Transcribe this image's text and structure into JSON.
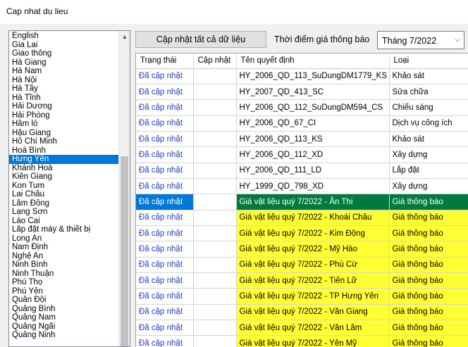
{
  "window": {
    "title": "Cap nhat du lieu"
  },
  "provinces": [
    "English",
    "Gia Lai",
    "Giao thông",
    "Hà Giang",
    "Hà Nam",
    "Hà Nội",
    "Hà Tây",
    "Hà Tĩnh",
    "Hải Dương",
    "Hải Phòng",
    "Hầm lò",
    "Hậu Giang",
    "Hồ Chí Minh",
    "Hoà Bình",
    "Hưng Yên",
    "Khánh Hoà",
    "Kiên Giang",
    "Kon Tum",
    "Lai Châu",
    "Lâm Đồng",
    "Lạng Sơn",
    "Lào Cai",
    "Lắp đặt máy & thiết bị",
    "Long An",
    "Nam Định",
    "Nghệ An",
    "Ninh Bình",
    "Ninh Thuận",
    "Phú Thọ",
    "Phú Yên",
    "Quân Đội",
    "Quảng Bình",
    "Quảng Nam",
    "Quảng Ngãi",
    "Quảng Ninh"
  ],
  "selected_province": "Hưng Yên",
  "toolbar": {
    "update_all_label": "Cập nhật tất cả dữ liệu",
    "time_label": "Thời điểm giá thông báo",
    "time_value": "Tháng 7/2022"
  },
  "grid": {
    "columns": [
      "Trạng thái",
      "Cập nhật",
      "Tên quyết định",
      "Loại"
    ],
    "rows": [
      {
        "status": "Đã cập nhật",
        "update": "",
        "name": "HY_2006_QD_113_SuDungDM1779_KS",
        "type": "Khảo sát",
        "hl": ""
      },
      {
        "status": "Đã cập nhật",
        "update": "",
        "name": "HY_2007_QD_413_SC",
        "type": "Sửa chữa",
        "hl": ""
      },
      {
        "status": "Đã cập nhật",
        "update": "",
        "name": "HY_2006_QD_112_SuDungDM594_CS",
        "type": "Chiếu sáng",
        "hl": ""
      },
      {
        "status": "Đã cập nhật",
        "update": "",
        "name": "HY_2006_QD_67_CI",
        "type": "Dịch vụ công ích",
        "hl": ""
      },
      {
        "status": "Đã cập nhật",
        "update": "",
        "name": "HY_2006_QD_113_KS",
        "type": "Khảo sát",
        "hl": ""
      },
      {
        "status": "Đã cập nhật",
        "update": "",
        "name": "HY_2006_QD_112_XD",
        "type": "Xây dựng",
        "hl": ""
      },
      {
        "status": "Đã cập nhật",
        "update": "",
        "name": "HY_2006_QD_111_LD",
        "type": "Lắp đặt",
        "hl": ""
      },
      {
        "status": "Đã cập nhật",
        "update": "",
        "name": "HY_1999_QD_798_XD",
        "type": "Xây dựng",
        "hl": ""
      },
      {
        "status": "Đã cập nhật",
        "update": "",
        "name": "Giá vật liệu quý 7/2022 - Ân Thi",
        "type": "Giá thông báo",
        "hl": "current"
      },
      {
        "status": "Đã cập nhật",
        "update": "",
        "name": "Giá vật liệu quý 7/2022 - Khoái Châu",
        "type": "Giá thông báo",
        "hl": "yellow"
      },
      {
        "status": "Đã cập nhật",
        "update": "",
        "name": "Giá vật liệu quý 7/2022 - Kim Động",
        "type": "Giá thông báo",
        "hl": "yellow"
      },
      {
        "status": "Đã cập nhật",
        "update": "",
        "name": "Giá vật liệu quý 7/2022 - Mỹ Hào",
        "type": "Giá thông báo",
        "hl": "yellow"
      },
      {
        "status": "Đã cập nhật",
        "update": "",
        "name": "Giá vật liệu quý 7/2022 - Phù Cừ",
        "type": "Giá thông báo",
        "hl": "yellow"
      },
      {
        "status": "Đã cập nhật",
        "update": "",
        "name": "Giá vật liệu quý 7/2022 - Tiên Lữ",
        "type": "Giá thông báo",
        "hl": "yellow"
      },
      {
        "status": "Đã cập nhật",
        "update": "",
        "name": "Giá vật liệu quý 7/2022 - TP Hưng Yên",
        "type": "Giá thông báo",
        "hl": "yellow"
      },
      {
        "status": "Đã cập nhật",
        "update": "",
        "name": "Giá vật liệu quý 7/2022 - Văn Giang",
        "type": "Giá thông báo",
        "hl": "yellow"
      },
      {
        "status": "Đã cập nhật",
        "update": "",
        "name": "Giá vật liệu quý 7/2022 - Văn Lâm",
        "type": "Giá thông báo",
        "hl": "yellow"
      },
      {
        "status": "Đã cập nhật",
        "update": "",
        "name": "Giá vật liệu quý 7/2022 - Yên Mỹ",
        "type": "Giá thông báo",
        "hl": "yellow"
      }
    ]
  },
  "icons": {
    "scroll_up": "chevron-up-icon",
    "combo_arrow": "chevron-down-icon"
  }
}
